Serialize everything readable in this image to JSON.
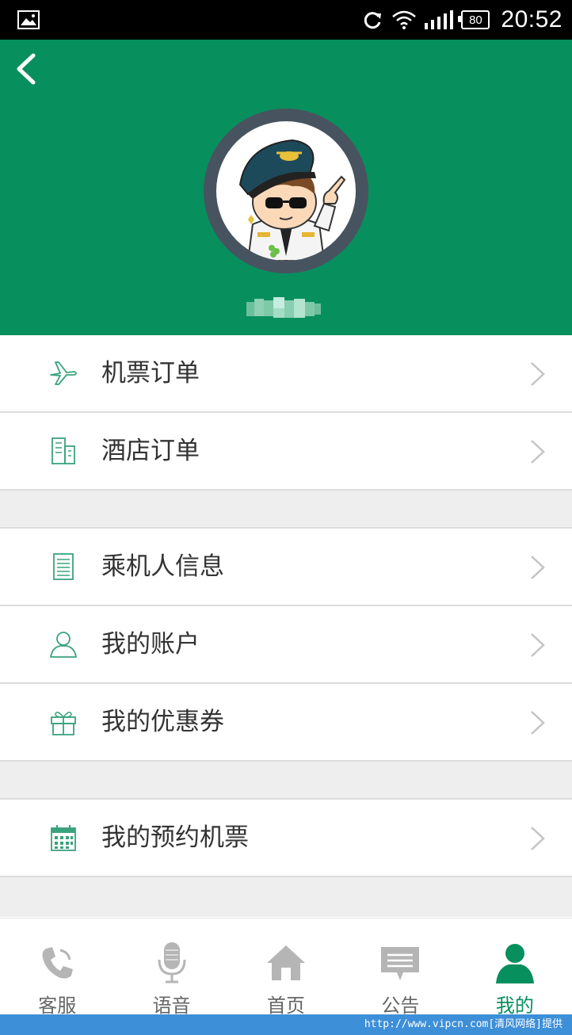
{
  "status_bar": {
    "time": "20:52",
    "battery": "80",
    "icons": [
      "gallery-icon",
      "sync-icon",
      "wifi-icon",
      "signal-icon",
      "battery-icon"
    ]
  },
  "header": {
    "back_icon": "back-chevron-icon",
    "avatar": "pilot-cartoon-avatar",
    "username": "",
    "bg_color": "#088f5e"
  },
  "menu": {
    "groups": [
      [
        {
          "label": "机票订单",
          "icon": "plane-icon"
        },
        {
          "label": "酒店订单",
          "icon": "hotel-icon"
        }
      ],
      [
        {
          "label": "乘机人信息",
          "icon": "document-icon"
        },
        {
          "label": "我的账户",
          "icon": "user-icon"
        },
        {
          "label": "我的优惠券",
          "icon": "gift-icon"
        }
      ],
      [
        {
          "label": "我的预约机票",
          "icon": "calendar-icon"
        }
      ]
    ]
  },
  "tabbar": {
    "items": [
      {
        "label": "客服",
        "icon": "phone-icon"
      },
      {
        "label": "语音",
        "icon": "microphone-icon"
      },
      {
        "label": "首页",
        "icon": "home-icon"
      },
      {
        "label": "公告",
        "icon": "message-icon"
      },
      {
        "label": "我的",
        "icon": "person-icon",
        "active": true
      }
    ],
    "active_color": "#088f5e"
  },
  "watermark": "http://www.vipcn.com[清风网络]提供"
}
